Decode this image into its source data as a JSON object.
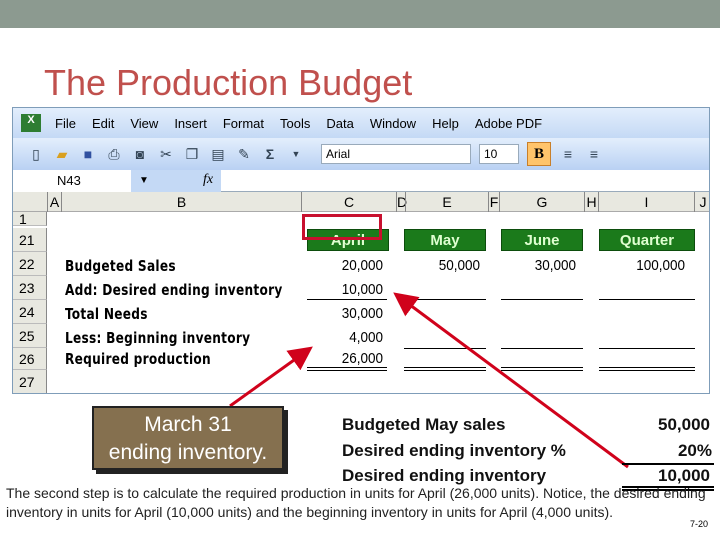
{
  "slide": {
    "title": "The Production Budget",
    "page_number": "7-20",
    "footer": "The second step is to calculate the required production in units for April (26,000 units). Notice, the desired ending inventory in units for April (10,000 units) and the beginning inventory in units for April (4,000 units)."
  },
  "excel": {
    "menu": [
      "File",
      "Edit",
      "View",
      "Insert",
      "Format",
      "Tools",
      "Data",
      "Window",
      "Help",
      "Adobe PDF"
    ],
    "toolbar": {
      "font": "Arial",
      "size": "10",
      "bold": "B",
      "sum": "Σ"
    },
    "name_box": "N43",
    "fx": "fx",
    "columns": [
      "A",
      "B",
      "C",
      "D",
      "E",
      "F",
      "G",
      "H",
      "I",
      "J"
    ],
    "rows": [
      "1",
      "21",
      "22",
      "23",
      "24",
      "25",
      "26",
      "27"
    ],
    "headers": [
      "April",
      "May",
      "June",
      "Quarter"
    ],
    "header_color": "#1b7a1b",
    "lines": [
      {
        "label": "Budgeted Sales",
        "values": [
          "20,000",
          "50,000",
          "30,000",
          "100,000"
        ]
      },
      {
        "label": "Add: Desired ending inventory",
        "values": [
          "10,000"
        ]
      },
      {
        "label": "Total Needs",
        "values": [
          "30,000"
        ]
      },
      {
        "label": "Less: Beginning inventory",
        "values": [
          "4,000"
        ]
      },
      {
        "label": "Required production",
        "values": [
          "26,000"
        ]
      }
    ]
  },
  "callout": {
    "line1": "March 31",
    "line2": "ending inventory.",
    "color": "#85704f"
  },
  "calculation": [
    {
      "label": "Budgeted May sales",
      "value": "50,000"
    },
    {
      "label": "Desired ending inventory %",
      "value": "20%"
    },
    {
      "label": "Desired ending inventory",
      "value": "10,000"
    }
  ],
  "arrow_color": "#d0021b"
}
